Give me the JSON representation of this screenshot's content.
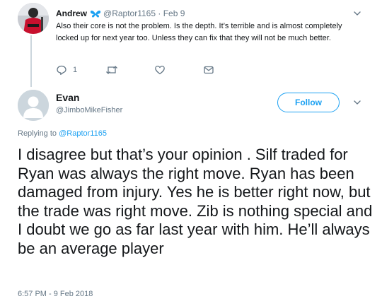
{
  "parent_tweet": {
    "author_name": "Andrew",
    "handle": "@Raptor1165",
    "separator": "·",
    "date": "Feb 9",
    "text": "Also their core is not the problem. Is the depth. It’s terrible and is almost completely locked up for next year too. Unless they can fix that they will not be much better.",
    "actions": {
      "reply_count": "1"
    },
    "icons": [
      "butterfly-badge-icon",
      "reply-icon",
      "retweet-icon",
      "like-icon",
      "dm-icon",
      "chevron-down-icon"
    ]
  },
  "main_tweet": {
    "author_name": "Evan",
    "handle": "@JimboMikeFisher",
    "follow_label": "Follow",
    "replying_prefix": "Replying to",
    "replying_to": "@Raptor1165",
    "text": "I disagree but that’s your opinion . Silf traded for Ryan was always the right move. Ryan has been damaged from injury. Yes he is better right now, but the trade was right move. Zib is nothing special and I doubt we go as far last year with him. He’ll always be an average player",
    "timestamp": "6:57 PM - 9 Feb 2018"
  },
  "colors": {
    "accent": "#1da1f2",
    "text": "#14171a",
    "secondary": "#657786",
    "thread_line": "#ccd6dd",
    "avatar_jersey": "#c8102e"
  }
}
